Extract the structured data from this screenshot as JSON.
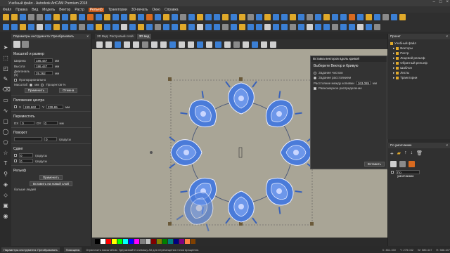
{
  "app": {
    "title": "Учебный файл - Autodesk ArtCAM Premium 2018"
  },
  "menu": [
    "Файл",
    "Правка",
    "Вид",
    "Модель",
    "Вектор",
    "Растр",
    "Рельеф",
    "Траектории",
    "3D-печать",
    "Окно",
    "Справка"
  ],
  "menu_active_index": 6,
  "left_panel": {
    "title": "Параметры инструмента: Преобразовать",
    "size_section": "Масштаб и размер",
    "width_label": "Ширина",
    "width_value": "186.447",
    "height_label": "Высота",
    "height_value": "186.447",
    "diag_label": "Диагональ (h)",
    "diag_value": "25.262",
    "proportional_label": "Пропорционально",
    "scale_label": "Масштаб",
    "scale_option_mm": "мм",
    "scale_option_pct": "Процентов %",
    "apply_label": "Применить",
    "cancel_label": "Отмена",
    "center_section": "Положение центра",
    "x_label": "X",
    "x_value": "199.662",
    "y_label": "Y",
    "y_value": "239.65",
    "unit_mm": "мм",
    "move_section": "Переместить",
    "dx_label": "DX",
    "dx_value": "0",
    "dy_label": "DY",
    "dy_value": "0",
    "rotate_section": "Поворот",
    "rotate_value": "0",
    "rotate_unit": "градусы",
    "shear_section": "Сдвиг",
    "shear_x_value": "0",
    "shear_y_value": "0",
    "shear_unit": "градусы",
    "relief_section": "Рельеф",
    "relief_apply": "Применить",
    "relief_new_layer": "Вставить на новый слой",
    "bigger_label": "больше людей"
  },
  "view_tabs": [
    "2D Вид: Растровый слой",
    "3D вид"
  ],
  "popup": {
    "header": "Вставка векторов вдоль кривой",
    "subtitle": "Выберите Вектор и Кривую",
    "option1": "Задание числом",
    "option2": "Задание расстоянием",
    "distance_label": "Расстояние между копиями",
    "distance_value": "163.085",
    "distance_unit": "мм",
    "evenly_label": "Равномерное распределение",
    "apply_label": "Вставить"
  },
  "project_panel": {
    "title": "Проект",
    "items": [
      "Учебный файл",
      "Векторы",
      "Растр",
      "Лицевой рельеф",
      "Обратный рельеф",
      "Шаблон",
      "Листы",
      "Траектории"
    ]
  },
  "defaults_panel": {
    "title": "По умолчанию",
    "field_value": "По умолчанию"
  },
  "status": {
    "tab1": "Параметры инструмента: Преобразовать",
    "tab2": "Помощник",
    "hint": "Ограничить масштабом. Удерживайте клавишу Alt для перемещения точки вращения.",
    "coord_x": "X: 461.150",
    "coord_y": "Y: 275.042",
    "w": "W: 586.447",
    "h": "H: 586.447"
  },
  "palette": [
    "#000000",
    "#ffffff",
    "#ff0000",
    "#ffff00",
    "#00ff00",
    "#00ffff",
    "#0000ff",
    "#ff00ff",
    "#808080",
    "#c0c0c0",
    "#800000",
    "#808000",
    "#008000",
    "#008080",
    "#000080",
    "#800080",
    "#ff8040",
    "#804000"
  ],
  "colors": {
    "accent": "#c85a1a",
    "ornament": "#4a7bd9",
    "canvas": "#a9a596"
  }
}
